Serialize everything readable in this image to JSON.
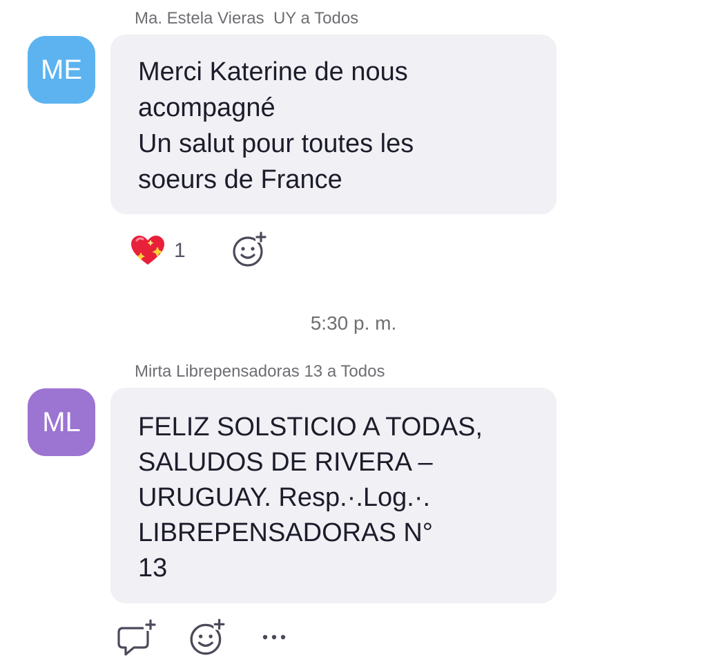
{
  "messages": [
    {
      "sender_line": "Ma. Estela Vieras  UY a Todos",
      "avatar_initials": "ME",
      "avatar_color": "#5cb3f0",
      "text_lines": [
        "Merci Katerine de nous",
        "acompagné",
        "Un salut pour toutes les",
        "soeurs de France"
      ],
      "reactions": [
        {
          "icon": "sparkling-heart-icon",
          "count": "1"
        }
      ],
      "add_reaction_icon": "add-reaction-icon"
    },
    {
      "sender_line": "Mirta Librepensadoras 13 a Todos",
      "avatar_initials": "ML",
      "avatar_color": "#9c74d2",
      "text_lines": [
        "FELIZ SOLSTICIO A TODAS,",
        "SALUDOS DE RIVERA –",
        "URUGUAY. Resp.·.Log.·.",
        "LIBREPENSADORAS N°",
        "13"
      ],
      "actions": [
        "reply-in-thread-icon",
        "add-reaction-icon",
        "more-options-icon"
      ]
    }
  ],
  "timestamp": "5:30 p. m.",
  "colors": {
    "bubble_bg": "#f0f0f5",
    "meta_text": "#6e6e73",
    "message_text": "#1c1c2a",
    "icon_stroke": "#4a4a5a"
  }
}
